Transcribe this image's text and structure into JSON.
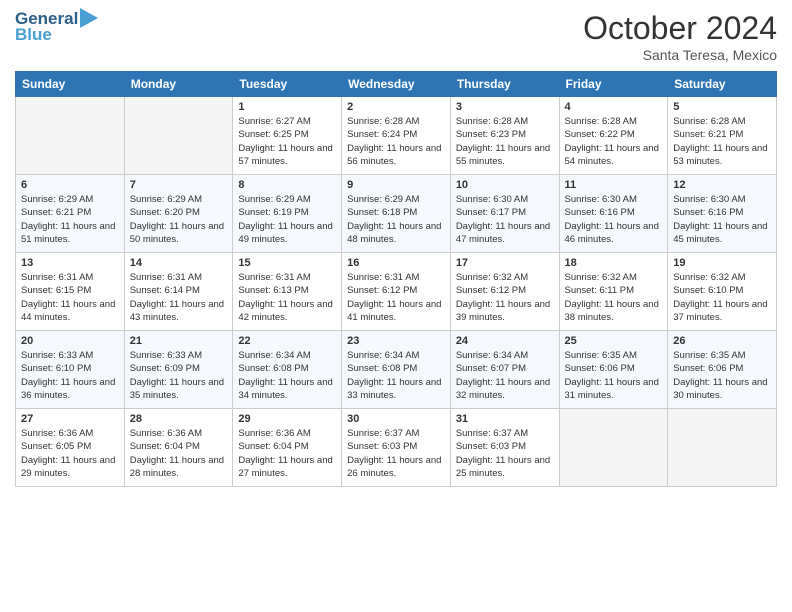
{
  "header": {
    "logo_line1": "General",
    "logo_line2": "Blue",
    "month_title": "October 2024",
    "location": "Santa Teresa, Mexico"
  },
  "days_of_week": [
    "Sunday",
    "Monday",
    "Tuesday",
    "Wednesday",
    "Thursday",
    "Friday",
    "Saturday"
  ],
  "weeks": [
    [
      {
        "day": "",
        "empty": true
      },
      {
        "day": "",
        "empty": true
      },
      {
        "day": "1",
        "sunrise": "Sunrise: 6:27 AM",
        "sunset": "Sunset: 6:25 PM",
        "daylight": "Daylight: 11 hours and 57 minutes."
      },
      {
        "day": "2",
        "sunrise": "Sunrise: 6:28 AM",
        "sunset": "Sunset: 6:24 PM",
        "daylight": "Daylight: 11 hours and 56 minutes."
      },
      {
        "day": "3",
        "sunrise": "Sunrise: 6:28 AM",
        "sunset": "Sunset: 6:23 PM",
        "daylight": "Daylight: 11 hours and 55 minutes."
      },
      {
        "day": "4",
        "sunrise": "Sunrise: 6:28 AM",
        "sunset": "Sunset: 6:22 PM",
        "daylight": "Daylight: 11 hours and 54 minutes."
      },
      {
        "day": "5",
        "sunrise": "Sunrise: 6:28 AM",
        "sunset": "Sunset: 6:21 PM",
        "daylight": "Daylight: 11 hours and 53 minutes."
      }
    ],
    [
      {
        "day": "6",
        "sunrise": "Sunrise: 6:29 AM",
        "sunset": "Sunset: 6:21 PM",
        "daylight": "Daylight: 11 hours and 51 minutes."
      },
      {
        "day": "7",
        "sunrise": "Sunrise: 6:29 AM",
        "sunset": "Sunset: 6:20 PM",
        "daylight": "Daylight: 11 hours and 50 minutes."
      },
      {
        "day": "8",
        "sunrise": "Sunrise: 6:29 AM",
        "sunset": "Sunset: 6:19 PM",
        "daylight": "Daylight: 11 hours and 49 minutes."
      },
      {
        "day": "9",
        "sunrise": "Sunrise: 6:29 AM",
        "sunset": "Sunset: 6:18 PM",
        "daylight": "Daylight: 11 hours and 48 minutes."
      },
      {
        "day": "10",
        "sunrise": "Sunrise: 6:30 AM",
        "sunset": "Sunset: 6:17 PM",
        "daylight": "Daylight: 11 hours and 47 minutes."
      },
      {
        "day": "11",
        "sunrise": "Sunrise: 6:30 AM",
        "sunset": "Sunset: 6:16 PM",
        "daylight": "Daylight: 11 hours and 46 minutes."
      },
      {
        "day": "12",
        "sunrise": "Sunrise: 6:30 AM",
        "sunset": "Sunset: 6:16 PM",
        "daylight": "Daylight: 11 hours and 45 minutes."
      }
    ],
    [
      {
        "day": "13",
        "sunrise": "Sunrise: 6:31 AM",
        "sunset": "Sunset: 6:15 PM",
        "daylight": "Daylight: 11 hours and 44 minutes."
      },
      {
        "day": "14",
        "sunrise": "Sunrise: 6:31 AM",
        "sunset": "Sunset: 6:14 PM",
        "daylight": "Daylight: 11 hours and 43 minutes."
      },
      {
        "day": "15",
        "sunrise": "Sunrise: 6:31 AM",
        "sunset": "Sunset: 6:13 PM",
        "daylight": "Daylight: 11 hours and 42 minutes."
      },
      {
        "day": "16",
        "sunrise": "Sunrise: 6:31 AM",
        "sunset": "Sunset: 6:12 PM",
        "daylight": "Daylight: 11 hours and 41 minutes."
      },
      {
        "day": "17",
        "sunrise": "Sunrise: 6:32 AM",
        "sunset": "Sunset: 6:12 PM",
        "daylight": "Daylight: 11 hours and 39 minutes."
      },
      {
        "day": "18",
        "sunrise": "Sunrise: 6:32 AM",
        "sunset": "Sunset: 6:11 PM",
        "daylight": "Daylight: 11 hours and 38 minutes."
      },
      {
        "day": "19",
        "sunrise": "Sunrise: 6:32 AM",
        "sunset": "Sunset: 6:10 PM",
        "daylight": "Daylight: 11 hours and 37 minutes."
      }
    ],
    [
      {
        "day": "20",
        "sunrise": "Sunrise: 6:33 AM",
        "sunset": "Sunset: 6:10 PM",
        "daylight": "Daylight: 11 hours and 36 minutes."
      },
      {
        "day": "21",
        "sunrise": "Sunrise: 6:33 AM",
        "sunset": "Sunset: 6:09 PM",
        "daylight": "Daylight: 11 hours and 35 minutes."
      },
      {
        "day": "22",
        "sunrise": "Sunrise: 6:34 AM",
        "sunset": "Sunset: 6:08 PM",
        "daylight": "Daylight: 11 hours and 34 minutes."
      },
      {
        "day": "23",
        "sunrise": "Sunrise: 6:34 AM",
        "sunset": "Sunset: 6:08 PM",
        "daylight": "Daylight: 11 hours and 33 minutes."
      },
      {
        "day": "24",
        "sunrise": "Sunrise: 6:34 AM",
        "sunset": "Sunset: 6:07 PM",
        "daylight": "Daylight: 11 hours and 32 minutes."
      },
      {
        "day": "25",
        "sunrise": "Sunrise: 6:35 AM",
        "sunset": "Sunset: 6:06 PM",
        "daylight": "Daylight: 11 hours and 31 minutes."
      },
      {
        "day": "26",
        "sunrise": "Sunrise: 6:35 AM",
        "sunset": "Sunset: 6:06 PM",
        "daylight": "Daylight: 11 hours and 30 minutes."
      }
    ],
    [
      {
        "day": "27",
        "sunrise": "Sunrise: 6:36 AM",
        "sunset": "Sunset: 6:05 PM",
        "daylight": "Daylight: 11 hours and 29 minutes."
      },
      {
        "day": "28",
        "sunrise": "Sunrise: 6:36 AM",
        "sunset": "Sunset: 6:04 PM",
        "daylight": "Daylight: 11 hours and 28 minutes."
      },
      {
        "day": "29",
        "sunrise": "Sunrise: 6:36 AM",
        "sunset": "Sunset: 6:04 PM",
        "daylight": "Daylight: 11 hours and 27 minutes."
      },
      {
        "day": "30",
        "sunrise": "Sunrise: 6:37 AM",
        "sunset": "Sunset: 6:03 PM",
        "daylight": "Daylight: 11 hours and 26 minutes."
      },
      {
        "day": "31",
        "sunrise": "Sunrise: 6:37 AM",
        "sunset": "Sunset: 6:03 PM",
        "daylight": "Daylight: 11 hours and 25 minutes."
      },
      {
        "day": "",
        "empty": true
      },
      {
        "day": "",
        "empty": true
      }
    ]
  ]
}
